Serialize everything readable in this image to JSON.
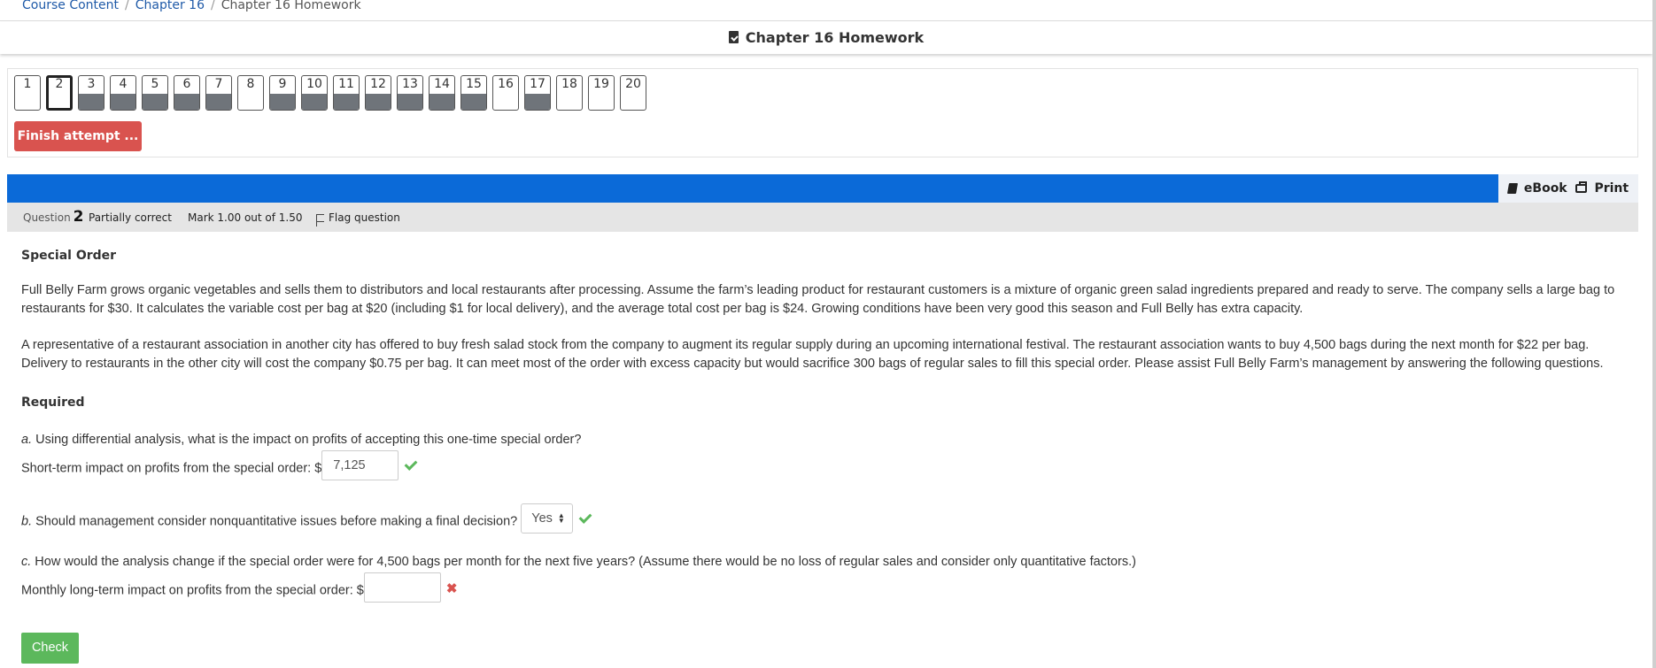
{
  "breadcrumb": {
    "items": [
      "Course Content",
      "Chapter 16",
      "Chapter 16 Homework"
    ]
  },
  "page_title": "Chapter 16 Homework",
  "quiz_nav": {
    "buttons": [
      {
        "label": "1",
        "state": "unanswered"
      },
      {
        "label": "2",
        "state": "current"
      },
      {
        "label": "3",
        "state": "partial"
      },
      {
        "label": "4",
        "state": "partial"
      },
      {
        "label": "5",
        "state": "partial"
      },
      {
        "label": "6",
        "state": "partial"
      },
      {
        "label": "7",
        "state": "partial"
      },
      {
        "label": "8",
        "state": "unanswered"
      },
      {
        "label": "9",
        "state": "partial"
      },
      {
        "label": "10",
        "state": "partial"
      },
      {
        "label": "11",
        "state": "partial"
      },
      {
        "label": "12",
        "state": "partial"
      },
      {
        "label": "13",
        "state": "partial"
      },
      {
        "label": "14",
        "state": "partial"
      },
      {
        "label": "15",
        "state": "partial"
      },
      {
        "label": "16",
        "state": "unanswered"
      },
      {
        "label": "17",
        "state": "partial"
      },
      {
        "label": "18",
        "state": "unanswered"
      },
      {
        "label": "19",
        "state": "unanswered"
      },
      {
        "label": "20",
        "state": "unanswered"
      }
    ],
    "finish_label": "Finish attempt ..."
  },
  "toolbar": {
    "ebook_label": "eBook",
    "print_label": "Print"
  },
  "question_info": {
    "prefix": "Question",
    "number": "2",
    "state": "Partially correct",
    "mark": "Mark 1.00 out of 1.50",
    "flag_label": "Flag question"
  },
  "question": {
    "heading": "Special Order",
    "paragraph1": "Full Belly Farm grows organic vegetables and sells them to distributors and local restaurants after processing. Assume the farm’s leading product for restaurant customers is a mixture of organic green salad ingredients prepared and ready to serve. The company sells a large bag to restaurants for $30. It calculates the variable cost per bag at $20 (including $1 for local delivery), and the average total cost per bag is $24. Growing conditions have been very good this season and Full Belly has extra capacity.",
    "paragraph2": "A representative of a restaurant association in another city has offered to buy fresh salad stock from the company to augment its regular supply during an upcoming international festival. The restaurant association wants to buy 4,500 bags during the next month for $22 per bag. Delivery to restaurants in the other city will cost the company $0.75 per bag. It can meet most of the order with excess capacity but would sacrifice 300 bags of regular sales to fill this special order. Please assist Full Belly Farm’s management by answering the following questions.",
    "required_label": "Required",
    "part_a": {
      "letter": "a.",
      "text": " Using differential analysis, what is the impact on profits of accepting this one-time special order?",
      "answer_label": "Short-term impact on profits from the special order: $",
      "answer_value": "7,125",
      "result": "correct"
    },
    "part_b": {
      "letter": "b.",
      "text": " Should management consider nonquantitative issues before making a final decision?",
      "selected_option": "Yes",
      "result": "correct"
    },
    "part_c": {
      "letter": "c.",
      "text": " How would the analysis change if the special order were for 4,500 bags per month for the next five years? (Assume there would be no loss of regular sales and consider only quantitative factors.)",
      "answer_label": "Monthly long-term impact on profits from the special order: $",
      "answer_value": "",
      "result": "incorrect"
    },
    "check_label": "Check"
  },
  "colors": {
    "header_blue": "#0b6ad8",
    "finish_red": "#d9534f",
    "check_green": "#5cb85c",
    "link_blue": "#1f5aa8"
  }
}
